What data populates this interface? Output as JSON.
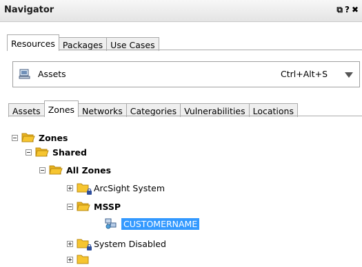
{
  "window": {
    "title": "Navigator",
    "controls": [
      "⧉",
      "?",
      "✖"
    ]
  },
  "top_tabs": [
    {
      "label": "Resources",
      "active": true
    },
    {
      "label": "Packages",
      "active": false
    },
    {
      "label": "Use Cases",
      "active": false
    }
  ],
  "resource_selector": {
    "value": "Assets",
    "shortcut": "Ctrl+Alt+S",
    "icon": "assets-icon"
  },
  "sub_tabs": [
    {
      "label": "Assets",
      "active": false
    },
    {
      "label": "Zones",
      "active": true
    },
    {
      "label": "Networks",
      "active": false
    },
    {
      "label": "Categories",
      "active": false
    },
    {
      "label": "Vulnerabilities",
      "active": false
    },
    {
      "label": "Locations",
      "active": false
    }
  ],
  "tree": [
    {
      "label": "Zones",
      "expander": "minus",
      "bold": true,
      "icon": "folder-icon"
    },
    {
      "label": "Shared",
      "expander": "minus",
      "bold": true,
      "icon": "folder-icon"
    },
    {
      "label": "All Zones",
      "expander": "minus",
      "bold": true,
      "icon": "folder-icon"
    },
    {
      "label": "ArcSight System",
      "expander": "plus",
      "bold": false,
      "icon": "locked-folder-icon"
    },
    {
      "label": "MSSP",
      "expander": "minus",
      "bold": true,
      "icon": "folder-icon"
    },
    {
      "label": "CUSTOMERNAME",
      "expander": "none",
      "bold": false,
      "icon": "zone-icon",
      "selected": true
    },
    {
      "label": "System Disabled",
      "expander": "plus",
      "bold": false,
      "icon": "locked-folder-icon"
    }
  ],
  "colors": {
    "selection": "#3399ff",
    "folder": "#f6c530"
  }
}
